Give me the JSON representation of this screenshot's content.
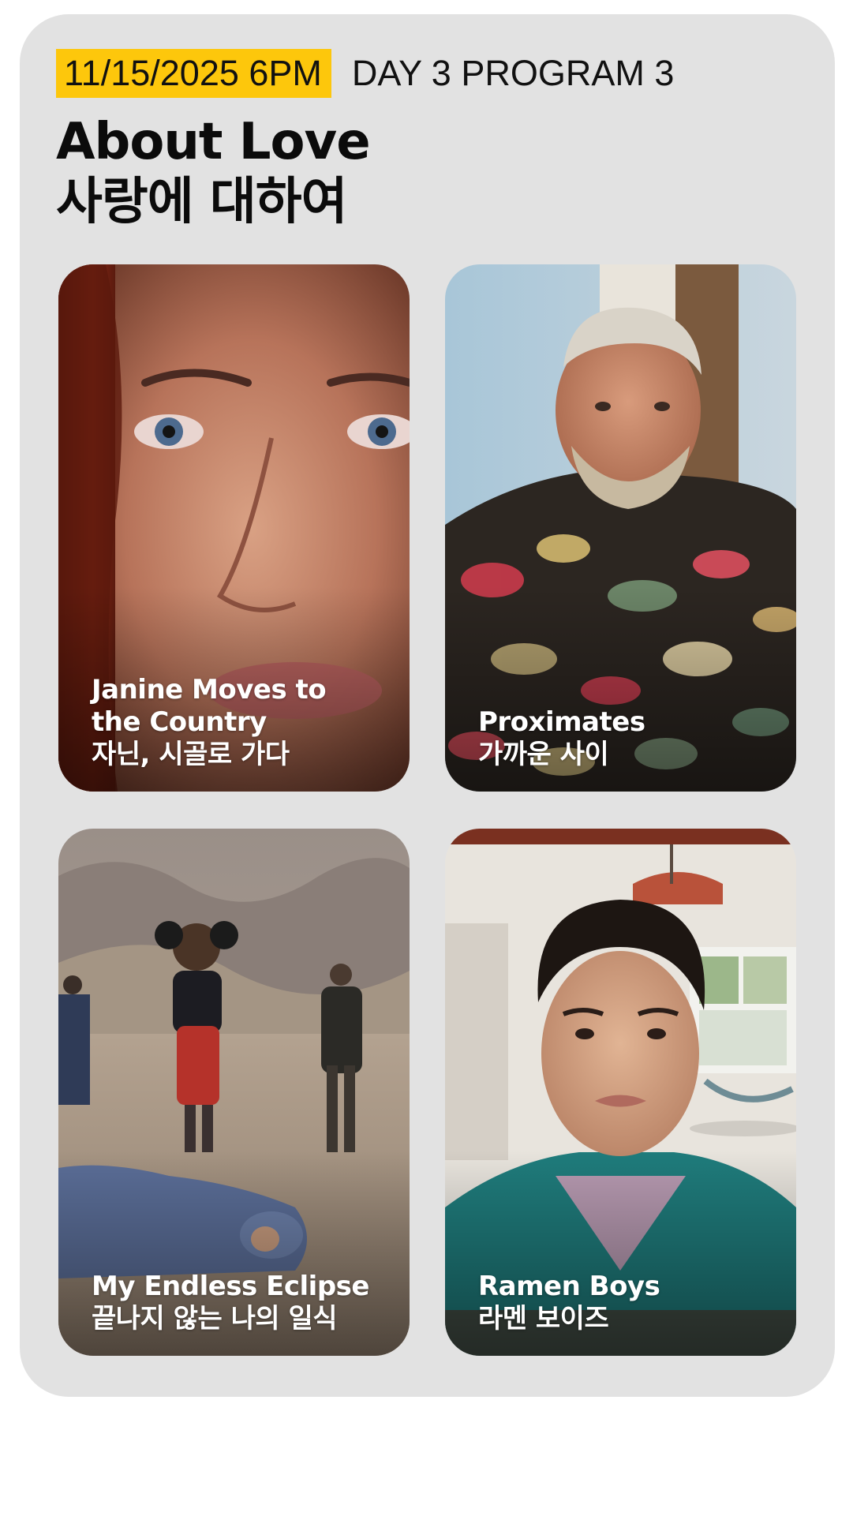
{
  "program": {
    "date_time": "11/15/2025 6PM",
    "day_program": "DAY 3 PROGRAM 3",
    "title_en": "About Love",
    "title_ko": "사랑에 대하여"
  },
  "films": [
    {
      "title_en": "Janine Moves to the Country",
      "title_en_line1": "Janine Moves to",
      "title_en_line2": "the Country",
      "title_ko": "자닌, 시골로 가다",
      "image_icon": "close-up-face-portrait"
    },
    {
      "title_en": "Proximates",
      "title_ko": "가까운 사이",
      "image_icon": "older-man-floral-shirt"
    },
    {
      "title_en": "My Endless Eclipse",
      "title_ko": "끝나지 않는 나의 일식",
      "image_icon": "desert-figures-mascot"
    },
    {
      "title_en": "Ramen Boys",
      "title_ko": "라멘 보이즈",
      "image_icon": "young-man-teal-shirt"
    }
  ],
  "colors": {
    "card_background": "#e2e2e2",
    "date_badge": "#fdc70c",
    "text_dark": "#111111",
    "caption_text": "#ffffff"
  }
}
